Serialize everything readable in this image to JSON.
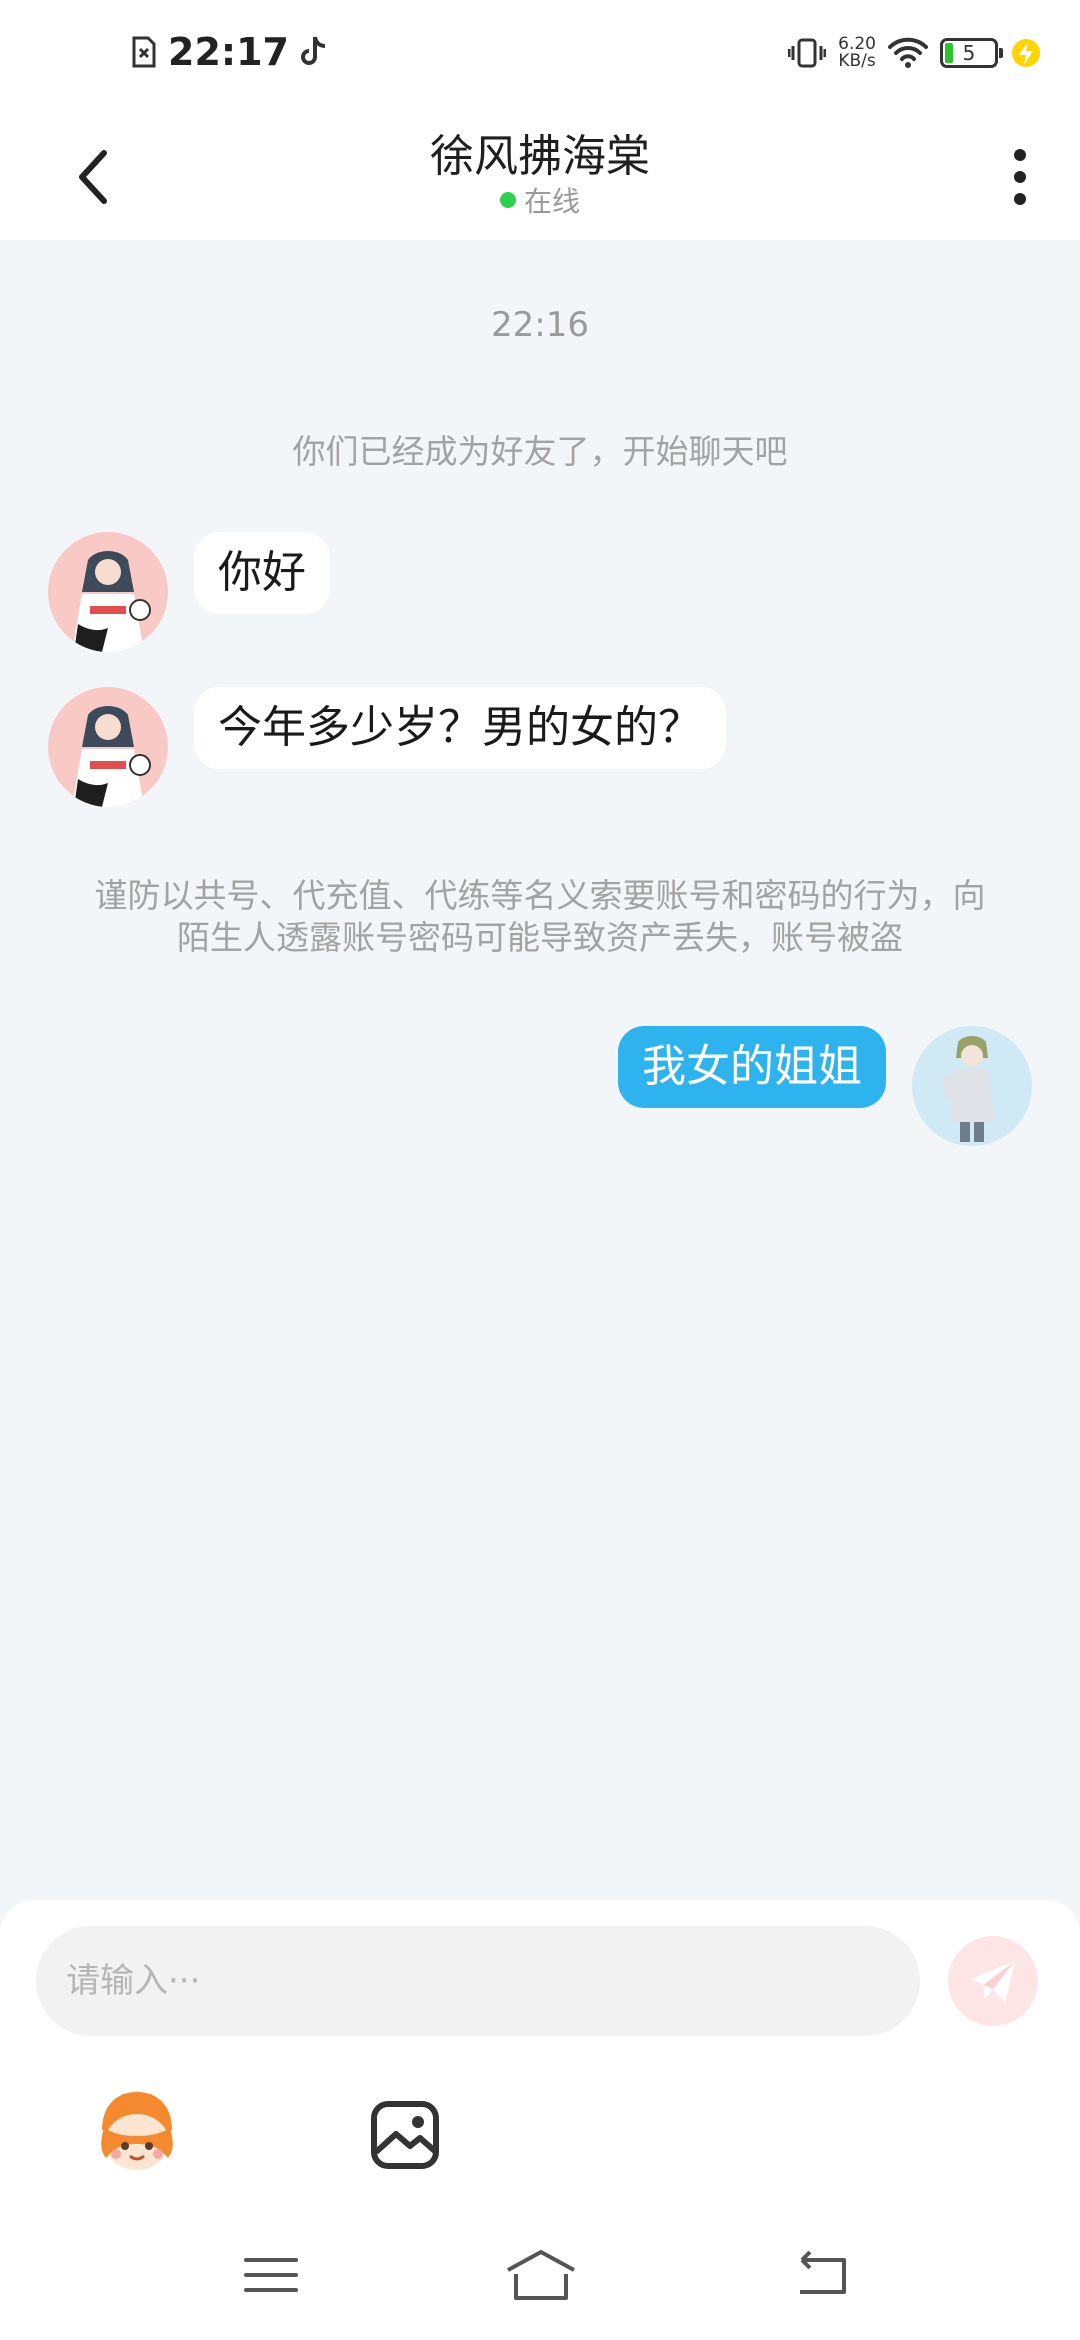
{
  "status_bar": {
    "time": "22:17",
    "net_speed_value": "6.20",
    "net_speed_unit": "KB/s",
    "battery": "5"
  },
  "header": {
    "title": "徐风拂海棠",
    "status": "在线"
  },
  "chat": {
    "timestamp": "22:16",
    "system_note": "你们已经成为好友了，开始聊天吧",
    "messages": [
      {
        "side": "left",
        "text": "你好"
      },
      {
        "side": "left",
        "text": "今年多少岁？男的女的？"
      },
      {
        "side": "right",
        "text": "我女的姐姐"
      }
    ],
    "warning": "谨防以共号、代充值、代练等名义索要账号和密码的行为，向陌生人透露账号密码可能导致资产丢失，账号被盗"
  },
  "composer": {
    "placeholder": "请输入···"
  },
  "colors": {
    "accent": "#2fb3ef",
    "online": "#2fcf4f",
    "background": "#f3f6f9"
  },
  "icons": {
    "back": "chevron-left-icon",
    "more": "more-vertical-icon",
    "send": "send-icon",
    "emoji": "emoji-mascot-icon",
    "image": "image-icon"
  }
}
